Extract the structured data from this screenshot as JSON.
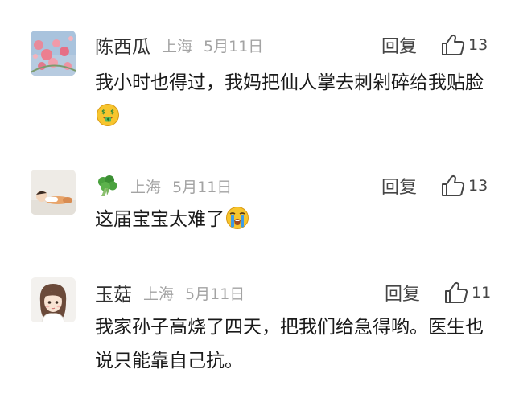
{
  "comments": [
    {
      "username": "陈西瓜",
      "location": "上海",
      "date": "5月11日",
      "reply_label": "回复",
      "like_count": "13",
      "text": "我小时也得过，我妈把仙人掌去刺剁碎给我贴脸",
      "emoji": "money-mouth-face-emoji"
    },
    {
      "username": "",
      "username_icon": "broccoli-emoji",
      "location": "上海",
      "date": "5月11日",
      "reply_label": "回复",
      "like_count": "13",
      "text": "这届宝宝太难了",
      "emoji": "loudly-crying-face-emoji"
    },
    {
      "username": "玉菇",
      "location": "上海",
      "date": "5月11日",
      "reply_label": "回复",
      "like_count": "11",
      "text": "我家孙子高烧了四天，把我们给急得哟。医生也说只能靠自己抗。"
    }
  ],
  "colors": {
    "meta_gray": "#a3a3a3",
    "text": "#1a1a1a",
    "icon": "#454545",
    "emoji_yellow": "#f7c52e",
    "emoji_blue": "#3f9be6"
  }
}
